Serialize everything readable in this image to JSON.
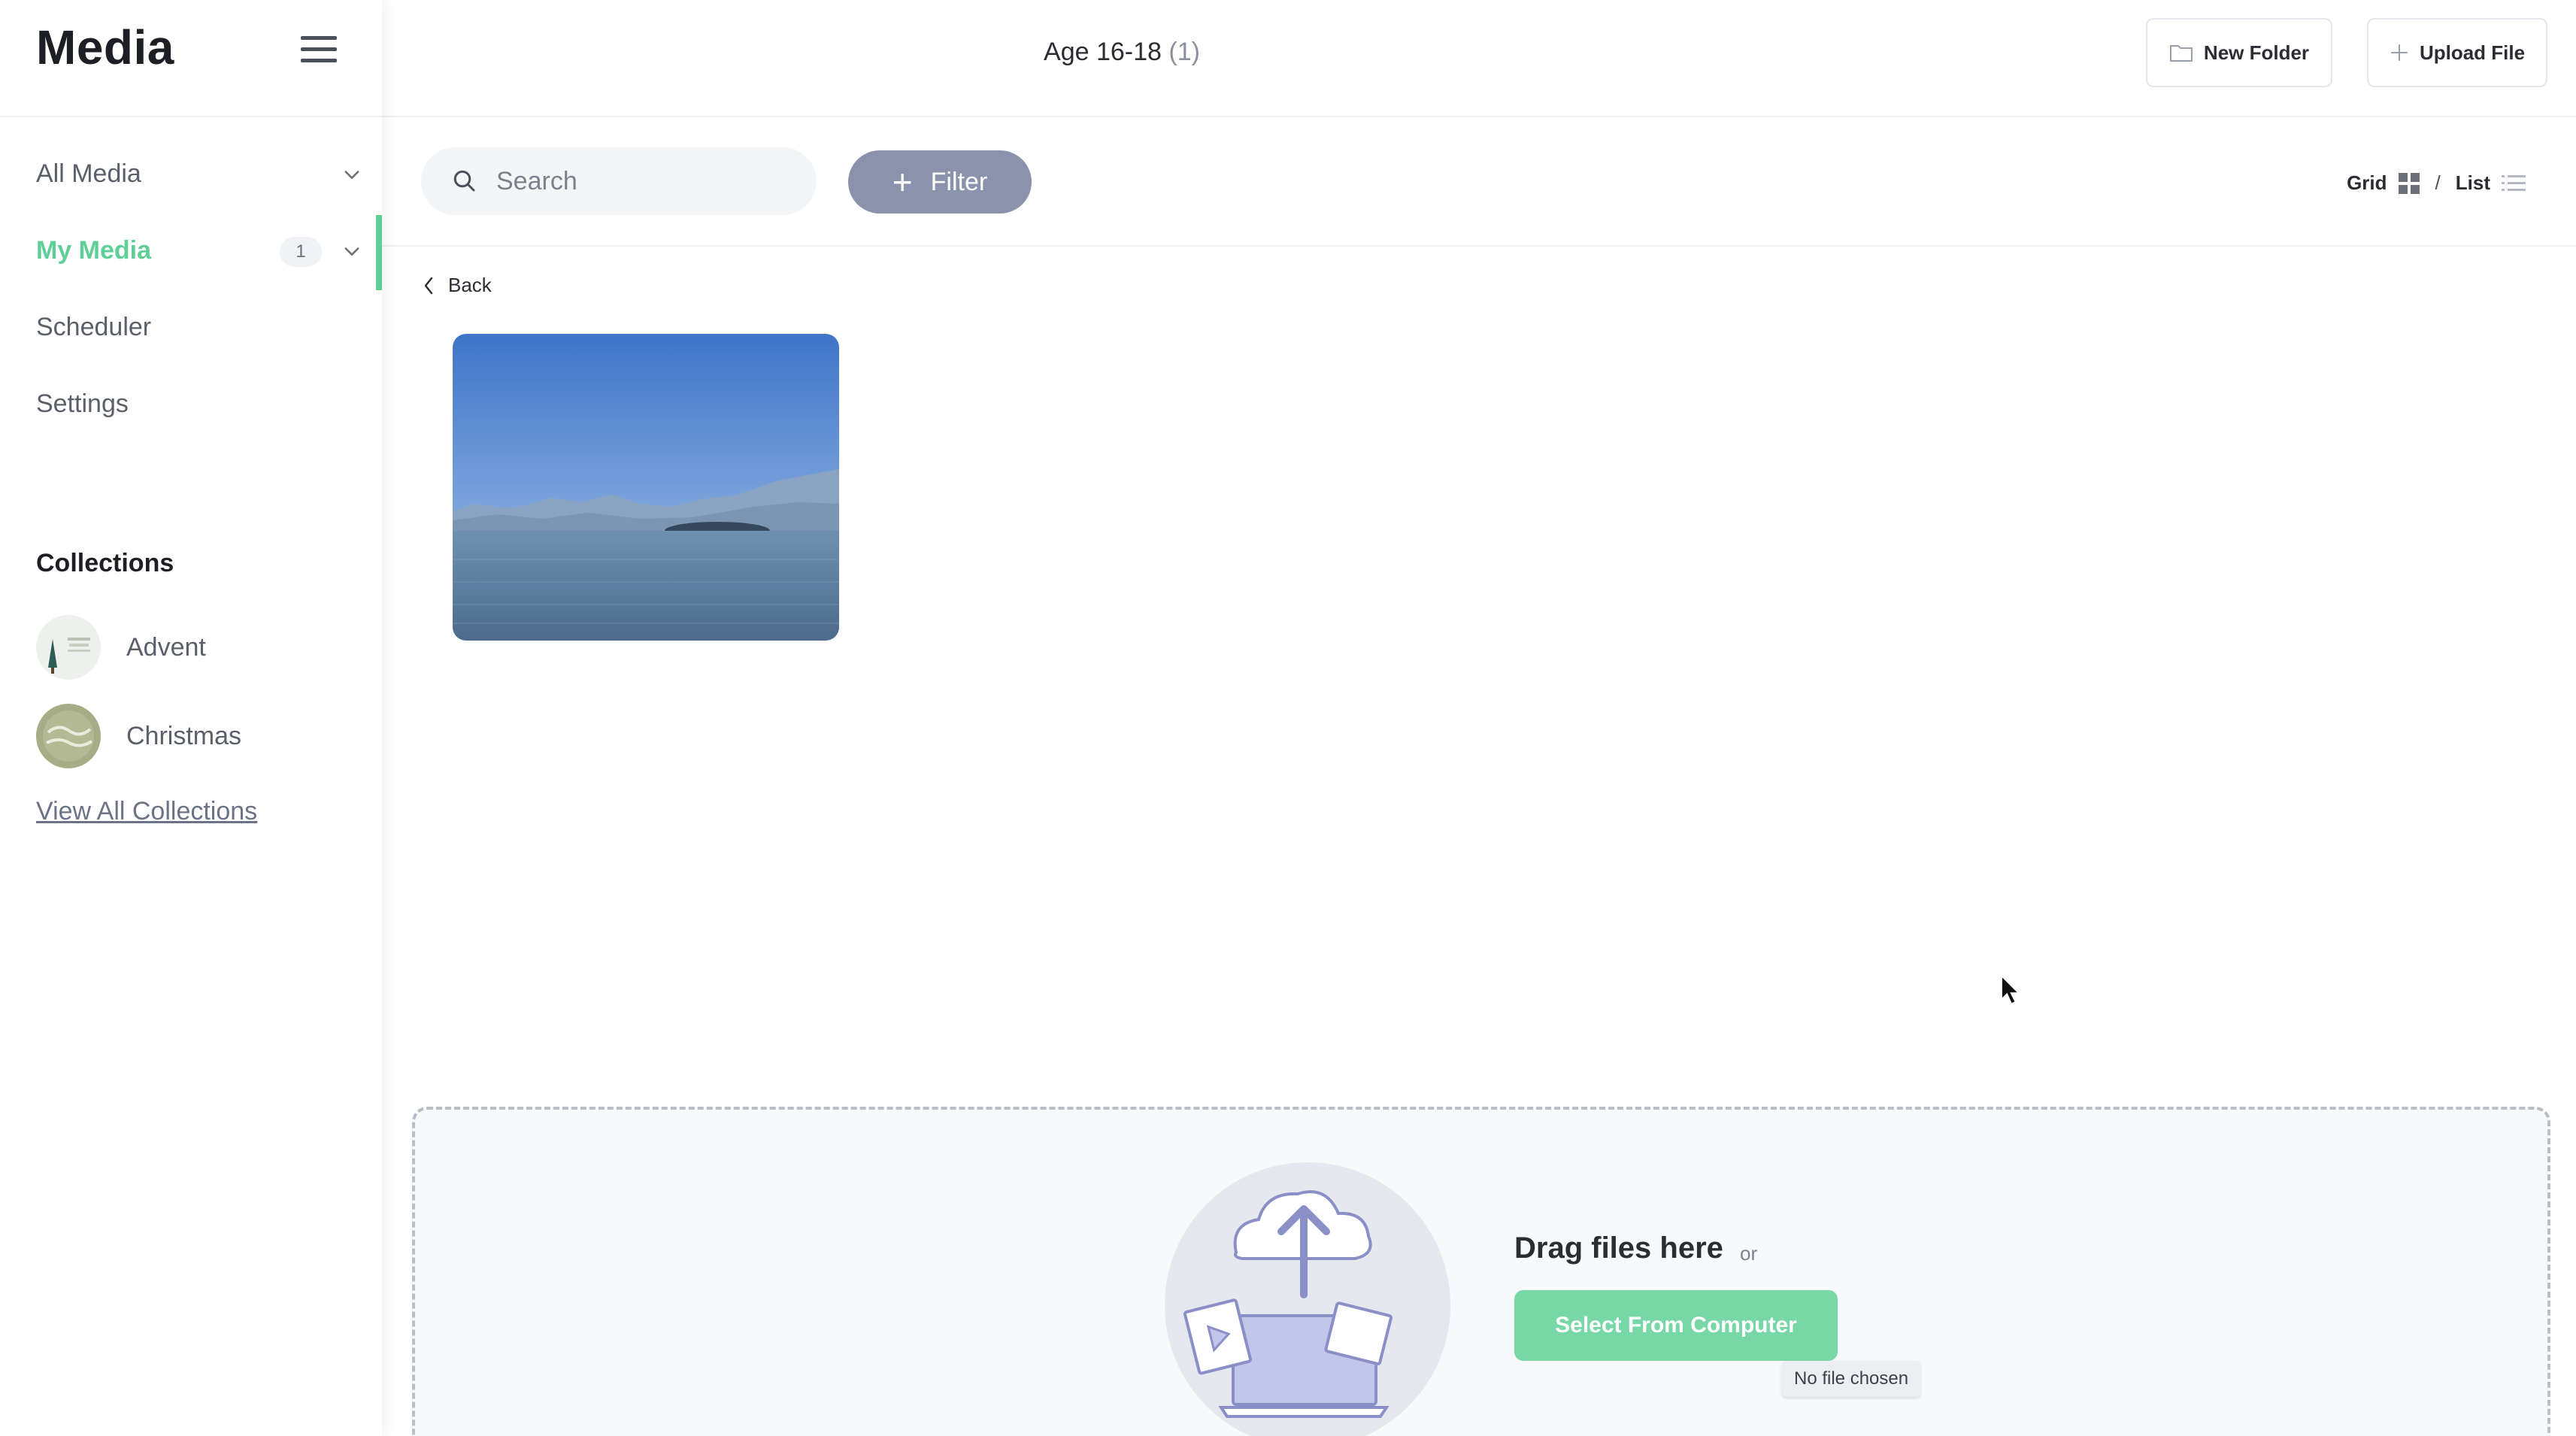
{
  "sidebar": {
    "brand": "Media",
    "nav": [
      {
        "label": "All Media"
      },
      {
        "label": "My Media",
        "badge": "1"
      },
      {
        "label": "Scheduler"
      },
      {
        "label": "Settings"
      }
    ],
    "collections_heading": "Collections",
    "collections": [
      {
        "label": "Advent"
      },
      {
        "label": "Christmas"
      }
    ],
    "view_all_label": "View All Collections"
  },
  "header": {
    "folder_name": "Age 16-18",
    "folder_count": "(1)",
    "new_folder_label": "New Folder",
    "upload_file_label": "Upload File"
  },
  "toolbar": {
    "search_placeholder": "Search",
    "filter_label": "Filter",
    "view_grid_label": "Grid",
    "view_separator": "/",
    "view_list_label": "List"
  },
  "content": {
    "back_label": "Back"
  },
  "upload": {
    "heading": "Drag files here",
    "or_label": "or",
    "select_button_label": "Select From Computer",
    "file_status": "No file chosen"
  },
  "colors": {
    "accent_green": "#5fcf98",
    "filter_button": "#8a93ab",
    "select_button": "#78d7a7"
  },
  "icons": {
    "menu": "hamburger-icon",
    "chevron": "chevron-down-icon",
    "search": "search-icon",
    "folder": "folder-icon",
    "upload": "plus-icon",
    "grid": "grid-icon",
    "list": "list-icon",
    "back": "chevron-left-icon",
    "dropzone": "cloud-upload-illustration"
  }
}
